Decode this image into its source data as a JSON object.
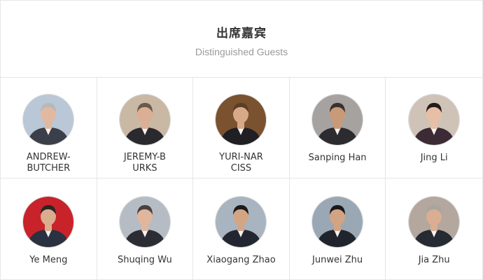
{
  "header": {
    "title_cn": "出席嘉宾",
    "title_en": "Distinguished Guests"
  },
  "guests": [
    {
      "name": "ANDREW-BUTCHER",
      "bg": "#b9c7d6",
      "suit": "#3a3f4a",
      "skin": "#e2b9a0",
      "hair": "#b8b8b8"
    },
    {
      "name": "JEREMY-BURKS",
      "bg": "#c9b8a4",
      "suit": "#2a2a2e",
      "skin": "#dcae93",
      "hair": "#6a5a4a"
    },
    {
      "name": "YURI-NARCISS",
      "bg": "#7a5230",
      "suit": "#1f1f24",
      "skin": "#d8a988",
      "hair": "#5a3e24"
    },
    {
      "name": "Sanping Han",
      "bg": "#a6a2a0",
      "suit": "#2b2b30",
      "skin": "#c99a78",
      "hair": "#3a3030"
    },
    {
      "name": "Jing Li",
      "bg": "#cfc3b8",
      "suit": "#3c2a35",
      "skin": "#e6bfa6",
      "hair": "#241c1c"
    },
    {
      "name": "Ye Meng",
      "bg": "#c8232a",
      "suit": "#2a3140",
      "skin": "#d9ad8e",
      "hair": "#2a2626"
    },
    {
      "name": "Shuqing Wu",
      "bg": "#b5bcc4",
      "suit": "#2c2c34",
      "skin": "#e0b69c",
      "hair": "#4a4040"
    },
    {
      "name": "Xiaogang Zhao",
      "bg": "#a8b4bf",
      "suit": "#222630",
      "skin": "#d4a584",
      "hair": "#1e1a1a"
    },
    {
      "name": "Junwei Zhu",
      "bg": "#9aa8b5",
      "suit": "#20242c",
      "skin": "#d2a484",
      "hair": "#1c1818"
    },
    {
      "name": "Jia Zhu",
      "bg": "#b3a79e",
      "suit": "#262a32",
      "skin": "#d9ae92",
      "hair": "#a8a4a0"
    }
  ]
}
